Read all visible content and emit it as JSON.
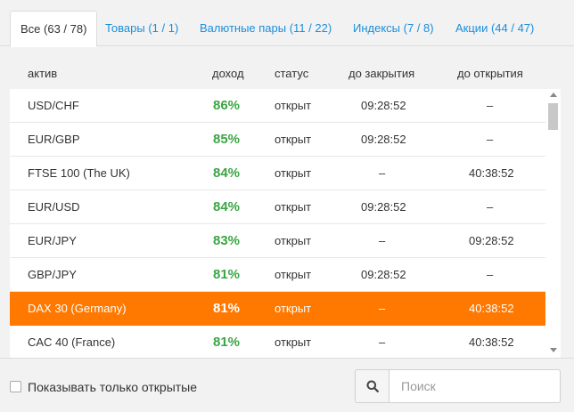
{
  "tabs": [
    {
      "label": "Все (63 / 78)",
      "active": true
    },
    {
      "label": "Товары (1 / 1)"
    },
    {
      "label": "Валютные пары (11 / 22)"
    },
    {
      "label": "Индексы (7 / 8)"
    },
    {
      "label": "Акции (44 / 47)"
    }
  ],
  "columns": {
    "asset": "актив",
    "income": "доход",
    "status": "статус",
    "to_close": "до закрытия",
    "to_open": "до открытия"
  },
  "rows": [
    {
      "asset": "USD/CHF",
      "income": "86%",
      "status": "открыт",
      "to_close": "09:28:52",
      "to_open": "–"
    },
    {
      "asset": "EUR/GBP",
      "income": "85%",
      "status": "открыт",
      "to_close": "09:28:52",
      "to_open": "–"
    },
    {
      "asset": "FTSE 100 (The UK)",
      "income": "84%",
      "status": "открыт",
      "to_close": "–",
      "to_open": "40:38:52"
    },
    {
      "asset": "EUR/USD",
      "income": "84%",
      "status": "открыт",
      "to_close": "09:28:52",
      "to_open": "–"
    },
    {
      "asset": "EUR/JPY",
      "income": "83%",
      "status": "открыт",
      "to_close": "–",
      "to_open": "09:28:52"
    },
    {
      "asset": "GBP/JPY",
      "income": "81%",
      "status": "открыт",
      "to_close": "09:28:52",
      "to_open": "–"
    },
    {
      "asset": "DAX 30 (Germany)",
      "income": "81%",
      "status": "открыт",
      "to_close": "–",
      "to_open": "40:38:52",
      "highlight": true
    },
    {
      "asset": "CAC 40 (France)",
      "income": "81%",
      "status": "открыт",
      "to_close": "–",
      "to_open": "40:38:52"
    }
  ],
  "footer": {
    "checkbox_label": "Показывать только открытые",
    "search_placeholder": "Поиск",
    "search_icon": "search-icon"
  },
  "colors": {
    "accent": "#1a8fdc",
    "income": "#3aa644",
    "highlight": "#ff7800"
  }
}
